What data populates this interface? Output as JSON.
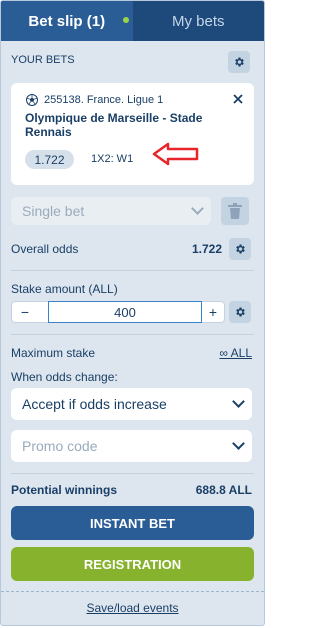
{
  "tabs": [
    {
      "label": "Bet slip (1)",
      "active": true,
      "has_dot": true
    },
    {
      "label": "My bets",
      "active": false
    }
  ],
  "your_bets": {
    "label": "YOUR BETS"
  },
  "bet_card": {
    "event_id": "255138. France. Ligue 1",
    "match": "Olympique de Marseille - Stade Rennais",
    "odds": "1.722",
    "market": "1X2: W1",
    "sport_icon": "soccer-ball-icon",
    "annotation_arrow_color": "#e8252b"
  },
  "bet_type": {
    "value": "Single bet"
  },
  "overall_odds": {
    "label": "Overall odds",
    "value": "1.722"
  },
  "stake": {
    "label": "Stake amount (ALL)",
    "value": "400",
    "minus": "−",
    "plus": "+"
  },
  "maximum_stake": {
    "label": "Maximum stake",
    "link": "∞ ALL"
  },
  "odds_change": {
    "label": "When odds change:",
    "value": "Accept if odds increase"
  },
  "promo": {
    "placeholder": "Promo code"
  },
  "potential_winnings": {
    "label": "Potential winnings",
    "value": "688.8 ALL"
  },
  "buttons": {
    "instant_bet": "INSTANT BET",
    "registration": "REGISTRATION"
  },
  "footer": {
    "link": "Save/load events"
  },
  "colors": {
    "tab_bar": "#1e4a7b",
    "tab_active": "#2a5d96",
    "primary_button": "#2a5d96",
    "registration_button": "#86b22d",
    "panel_bg": "#dde6ef",
    "text": "#1a3f66"
  }
}
